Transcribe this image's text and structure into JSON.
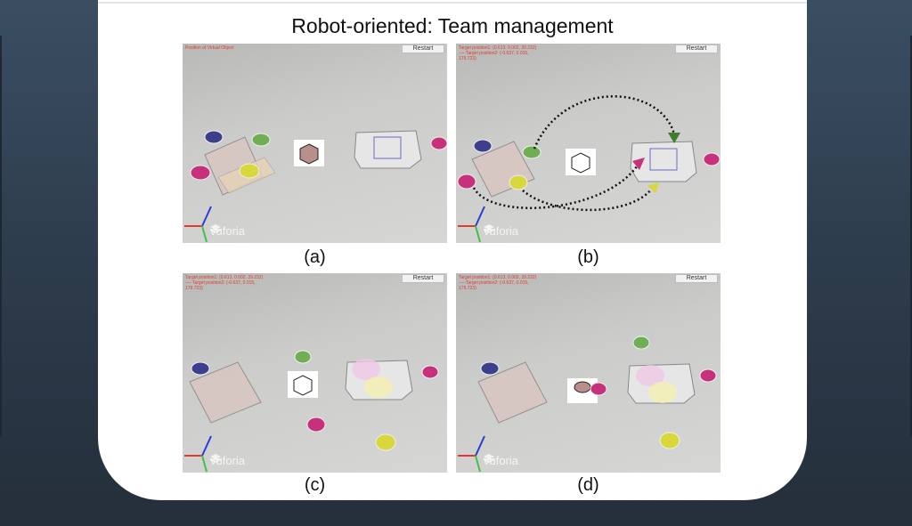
{
  "title": "Robot-oriented: Team management",
  "panels": [
    {
      "caption": "(a)",
      "restart_label": "Restart",
      "readout": "Position of Virtual Object",
      "watermark": "vuforia"
    },
    {
      "caption": "(b)",
      "restart_label": "Restart",
      "readout": "Target position1: (0.613, 0.002, 39.232)\n---- Target position2: (-0.637, 0.015,\n179.723)",
      "watermark": "vuforia"
    },
    {
      "caption": "(c)",
      "restart_label": "Restart",
      "readout": "Target position1: (0.613, 0.002, 39.232)\n---- Target position2: (-0.637, 0.015,\n179.723)",
      "watermark": "vuforia"
    },
    {
      "caption": "(d)",
      "restart_label": "Restart",
      "readout": "Target position1: (0.613, 0.002, 39.232)\n---- Target position2: (-0.637, 0.015,\n179.723)",
      "watermark": "vuforia"
    }
  ],
  "colors": {
    "background_top": "#3a4e62",
    "slide": "#ffffff",
    "readout_text": "#e03a2e",
    "robot_pink": "#c7307a",
    "robot_green": "#6fae52",
    "robot_blue": "#3b3f8c",
    "robot_yellow": "#d8d83c",
    "path_dots": "#111111"
  },
  "icons": [
    "axis-gizmo-icon",
    "vuforia-logo-icon",
    "path-arrow-icon"
  ]
}
